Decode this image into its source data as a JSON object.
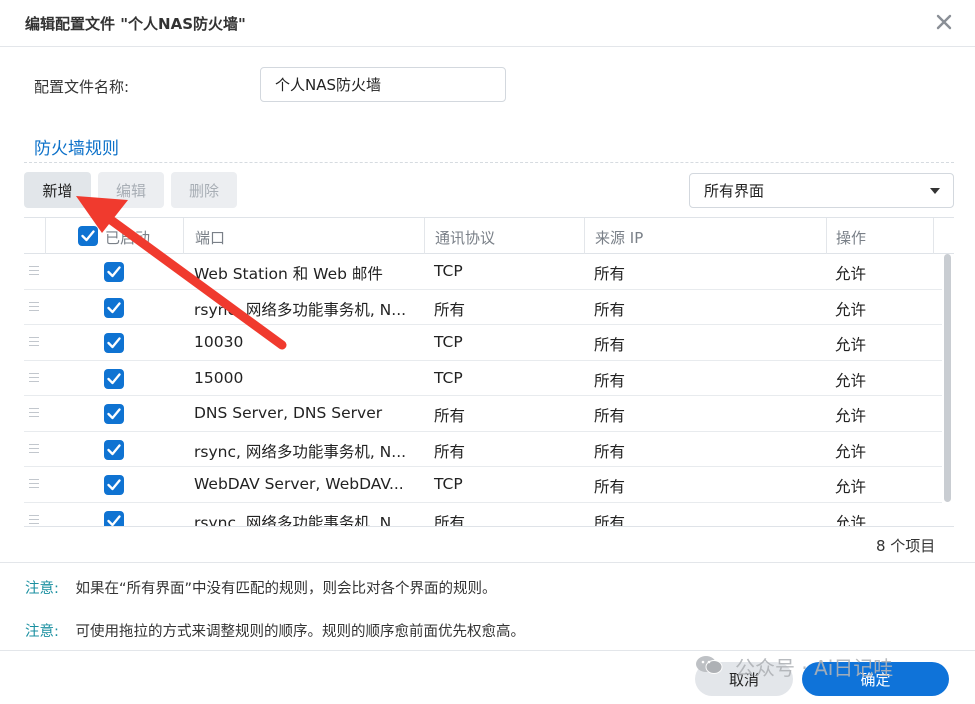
{
  "dialog": {
    "title": "编辑配置文件 \"个人NAS防火墙\""
  },
  "form": {
    "name_label": "配置文件名称:",
    "name_value": "个人NAS防火墙"
  },
  "section": {
    "title": "防火墙规则"
  },
  "toolbar": {
    "add_label": "新增",
    "edit_label": "编辑",
    "delete_label": "删除",
    "interface_select": "所有界面"
  },
  "table": {
    "headers": {
      "enabled": "已启动",
      "port": "端口",
      "protocol": "通讯协议",
      "source_ip": "来源 IP",
      "action": "操作"
    },
    "rows": [
      {
        "enabled": true,
        "port": "Web Station 和 Web 邮件",
        "protocol": "TCP",
        "source_ip": "所有",
        "action": "允许"
      },
      {
        "enabled": true,
        "port": "rsync, 网络多功能事务机, N...",
        "protocol": "所有",
        "source_ip": "所有",
        "action": "允许"
      },
      {
        "enabled": true,
        "port": "10030",
        "protocol": "TCP",
        "source_ip": "所有",
        "action": "允许"
      },
      {
        "enabled": true,
        "port": "15000",
        "protocol": "TCP",
        "source_ip": "所有",
        "action": "允许"
      },
      {
        "enabled": true,
        "port": "DNS Server, DNS Server",
        "protocol": "所有",
        "source_ip": "所有",
        "action": "允许"
      },
      {
        "enabled": true,
        "port": "rsync, 网络多功能事务机, N...",
        "protocol": "所有",
        "source_ip": "所有",
        "action": "允许"
      },
      {
        "enabled": true,
        "port": "WebDAV Server, WebDAV...",
        "protocol": "TCP",
        "source_ip": "所有",
        "action": "允许"
      },
      {
        "enabled": true,
        "port": "rsync, 网络多功能事务机, N...",
        "protocol": "所有",
        "source_ip": "所有",
        "action": "允许"
      }
    ],
    "item_count": "8 个项目"
  },
  "notes": [
    {
      "label": "注意:",
      "text": "如果在“所有界面”中没有匹配的规则，则会比对各个界面的规则。"
    },
    {
      "label": "注意:",
      "text": "可使用拖拉的方式来调整规则的顺序。规则的顺序愈前面优先权愈高。"
    }
  ],
  "footer": {
    "cancel_label": "取消",
    "ok_label": "确定"
  },
  "watermark": {
    "text": "公众号 · Ai日记哇"
  },
  "colors": {
    "accent": "#0f73d9",
    "annotation_arrow": "#f03a2e",
    "section_title": "#0c71c9",
    "note_label": "#1a8fa0"
  }
}
